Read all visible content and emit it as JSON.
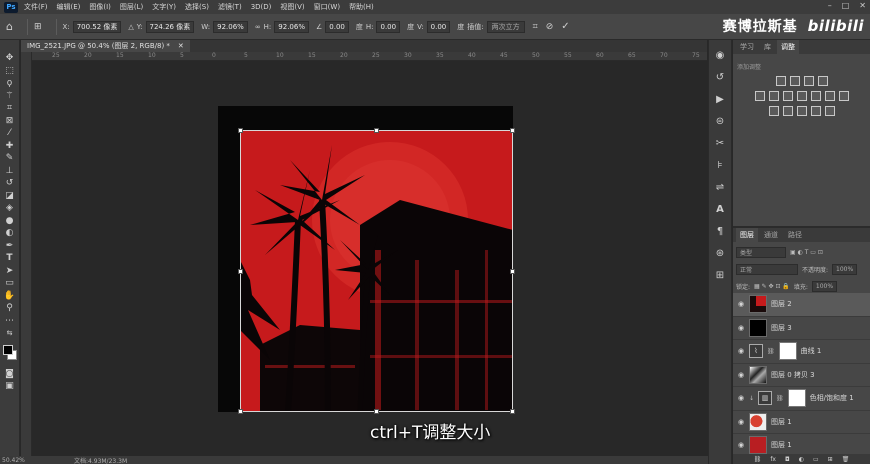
{
  "menubar": {
    "items": [
      "文件(F)",
      "编辑(E)",
      "图像(I)",
      "图层(L)",
      "文字(Y)",
      "选择(S)",
      "滤镜(T)",
      "3D(D)",
      "视图(V)",
      "窗口(W)",
      "帮助(H)"
    ],
    "logo_text": "Ps"
  },
  "options": {
    "x_label": "X:",
    "x_value": "700.52 像素",
    "y_label": "Y:",
    "y_value": "724.26 像素",
    "w_label": "W:",
    "w_value": "92.06%",
    "h_label": "H:",
    "h_value": "92.06%",
    "angle_value": "0.00",
    "angle_unit": "度",
    "hskew_label": "H:",
    "hskew_value": "0.00",
    "hskew_unit": "度",
    "vskew_label": "V:",
    "vskew_value": "0.00",
    "vskew_unit": "度",
    "interp_label": "插值:",
    "interp_value": "两次立方"
  },
  "brand": {
    "name": "赛博拉斯基",
    "logo": "bilibili"
  },
  "document": {
    "tab_title": "IMG_2521.JPG @ 50.4% (图层 2, RGB/8) *",
    "ruler_numbers": [
      "25",
      "20",
      "15",
      "10",
      "5",
      "0",
      "5",
      "10",
      "15",
      "20",
      "25",
      "30",
      "35",
      "40",
      "45",
      "50",
      "55",
      "60",
      "65",
      "70",
      "75"
    ]
  },
  "subtitle": "ctrl+T调整大小",
  "status": {
    "zoom": "50.42%",
    "doc_info": "文档:4.93M/23.3M"
  },
  "adjustments": {
    "tabs": [
      "学习",
      "库",
      "调整"
    ],
    "active_tab": "调整",
    "subtitle": "添加调整"
  },
  "layers": {
    "tabs": [
      "图层",
      "通道",
      "路径"
    ],
    "active_tab": "图层",
    "kind_select": "类型",
    "blend_mode": "正常",
    "opacity_label": "不透明度:",
    "opacity_value": "100%",
    "lock_label": "锁定:",
    "fill_label": "填充:",
    "fill_value": "100%",
    "items": [
      {
        "name": "图层 2",
        "selected": true
      },
      {
        "name": "图层 3"
      },
      {
        "name": "曲线 1"
      },
      {
        "name": "图层 0 拷贝 3"
      },
      {
        "name": "色相/饱和度 1"
      },
      {
        "name": "图层 1"
      },
      {
        "name": "图层 1"
      }
    ],
    "footer_icons": [
      "link-icon",
      "fx-icon",
      "mask-icon",
      "adjustment-icon",
      "folder-icon",
      "new-layer-icon",
      "trash-icon"
    ]
  },
  "colors": {
    "accent_red": "#c61a1c",
    "panel": "#474747",
    "workspace": "#282828"
  }
}
